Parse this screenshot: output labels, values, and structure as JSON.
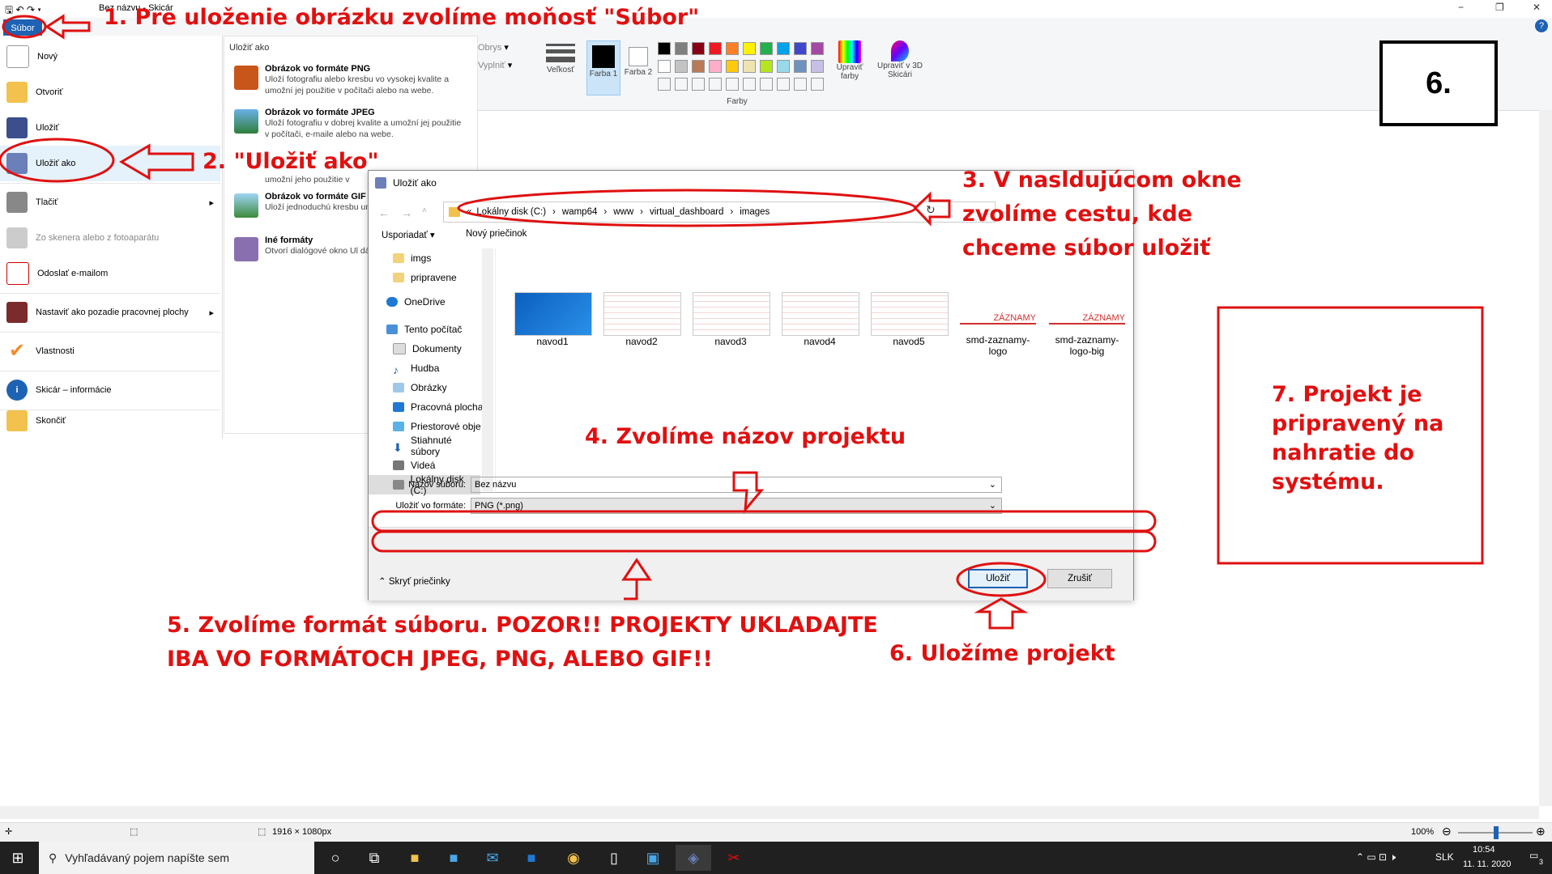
{
  "titlebar": {
    "title": "Bez názvu - Skicár",
    "minimize": "−",
    "restore": "❐",
    "close": "✕",
    "help": "?"
  },
  "ribbon": {
    "file_button": "Súbor",
    "outline_label": "Obrys",
    "fill_label": "Vyplniť",
    "size_label": "Veľkosť",
    "color1_label": "Farba 1",
    "color2_label": "Farba 2",
    "colors_group_label": "Farby",
    "edit_colors_label": "Upraviť farby",
    "paint3d_label": "Upraviť v 3D Skicári",
    "palette_row1": [
      "#000000",
      "#7f7f7f",
      "#880015",
      "#ed1c24",
      "#ff7f27",
      "#fff200",
      "#22b14c",
      "#00a2e8",
      "#3f48cc",
      "#a349a4"
    ],
    "palette_row2": [
      "#ffffff",
      "#c3c3c3",
      "#b97a57",
      "#ffaec9",
      "#ffc90e",
      "#efe4b0",
      "#b5e61d",
      "#99d9ea",
      "#7092be",
      "#c8bfe7"
    ]
  },
  "file_menu": {
    "items": [
      {
        "label": "Nový",
        "icon": "new-file-icon"
      },
      {
        "label": "Otvoriť",
        "icon": "open-folder-icon"
      },
      {
        "label": "Uložiť",
        "icon": "save-disk-icon"
      },
      {
        "label": "Uložiť ako",
        "icon": "save-as-icon"
      },
      {
        "label": "Tlačiť",
        "icon": "printer-icon"
      },
      {
        "label": "Zo skenera alebo z fotoaparátu",
        "icon": "scanner-icon"
      },
      {
        "label": "Odoslať e-mailom",
        "icon": "email-icon"
      },
      {
        "label": "Nastaviť ako pozadie pracovnej plochy",
        "icon": "desktop-icon"
      },
      {
        "label": "Vlastnosti",
        "icon": "checkmark-icon"
      },
      {
        "label": "Skicár – informácie",
        "icon": "info-icon"
      },
      {
        "label": "Skončiť",
        "icon": "exit-icon"
      }
    ]
  },
  "save_as_submenu": {
    "header": "Uložiť ako",
    "items": [
      {
        "title": "Obrázok vo formáte PNG",
        "desc": "Uloží fotografiu alebo kresbu vo vysokej kvalite a umožní jej použitie v počítači alebo na webe."
      },
      {
        "title": "Obrázok vo formáte JPEG",
        "desc": "Uloží fotografiu v dobrej kvalite a umožní jej použitie v počítači, e-maile alebo na webe."
      },
      {
        "title": "",
        "desc": "umožní jeho použitie v"
      },
      {
        "title": "Obrázok vo formáte GIF",
        "desc": "Uloží jednoduchú kresbu umožní jej použitie v e-ma"
      },
      {
        "title": "Iné formáty",
        "desc": "Otvorí dialógové okno Ul dá vybrať ľubovoľný typ sú"
      }
    ]
  },
  "dialog": {
    "title": "Uložiť ako",
    "breadcrumb": [
      "Lokálny disk (C:)",
      "wamp64",
      "www",
      "virtual_dashboard",
      "images"
    ],
    "organize": "Usporiadať",
    "new_folder": "Nový priečinok",
    "tree": [
      "imgs",
      "pripravene",
      "OneDrive",
      "Tento počítač",
      "Dokumenty",
      "Hudba",
      "Obrázky",
      "Pracovná plocha",
      "Priestorové obje",
      "Stiahnuté súbory",
      "Videá",
      "Lokálny disk (C:)"
    ],
    "files": [
      {
        "name": "navod1"
      },
      {
        "name": "navod2"
      },
      {
        "name": "navod3"
      },
      {
        "name": "navod4"
      },
      {
        "name": "navod5"
      },
      {
        "name": "smd-zaznamy-logo",
        "label": "ZÁZNAMY"
      },
      {
        "name": "smd-zaznamy-logo-big",
        "label": "ZÁZNAMY"
      }
    ],
    "filename_label": "Názov súboru:",
    "filename_value": "Bez názvu",
    "format_label": "Uložiť vo formáte:",
    "format_value": "PNG (*.png)",
    "hide_folders": "Skryť priečinky",
    "save": "Uložiť",
    "cancel": "Zrušiť"
  },
  "annotations": {
    "a1": "1. Pre uloženie obrázku zvolíme moňosť \"Súbor\"",
    "a2": "2. \"Uložiť ako\"",
    "a3_l1": "3. V nasldujúcom okne",
    "a3_l2": "zvolíme cestu, kde",
    "a3_l3": "chceme súbor uložiť",
    "a4": "4. Zvolíme názov projektu",
    "a5_l1": "5. Zvolíme formát súboru. POZOR!! PROJEKTY UKLADAJTE",
    "a5_l2": "IBA VO FORMÁTOCH JPEG, PNG, ALEBO GIF!!",
    "a6": "6. Uložíme projekt",
    "a7_l1": "7. Projekt je",
    "a7_l2": "pripravený na",
    "a7_l3": "nahratie do",
    "a7_l4": "systému.",
    "step_box": "6."
  },
  "statusbar": {
    "dimensions": "1916 × 1080px",
    "zoom": "100%"
  },
  "taskbar": {
    "search_placeholder": "Vyhľadávaný pojem napíšte sem",
    "language": "SLK",
    "time": "10:54",
    "date": "11. 11. 2020",
    "notifications": "3"
  }
}
